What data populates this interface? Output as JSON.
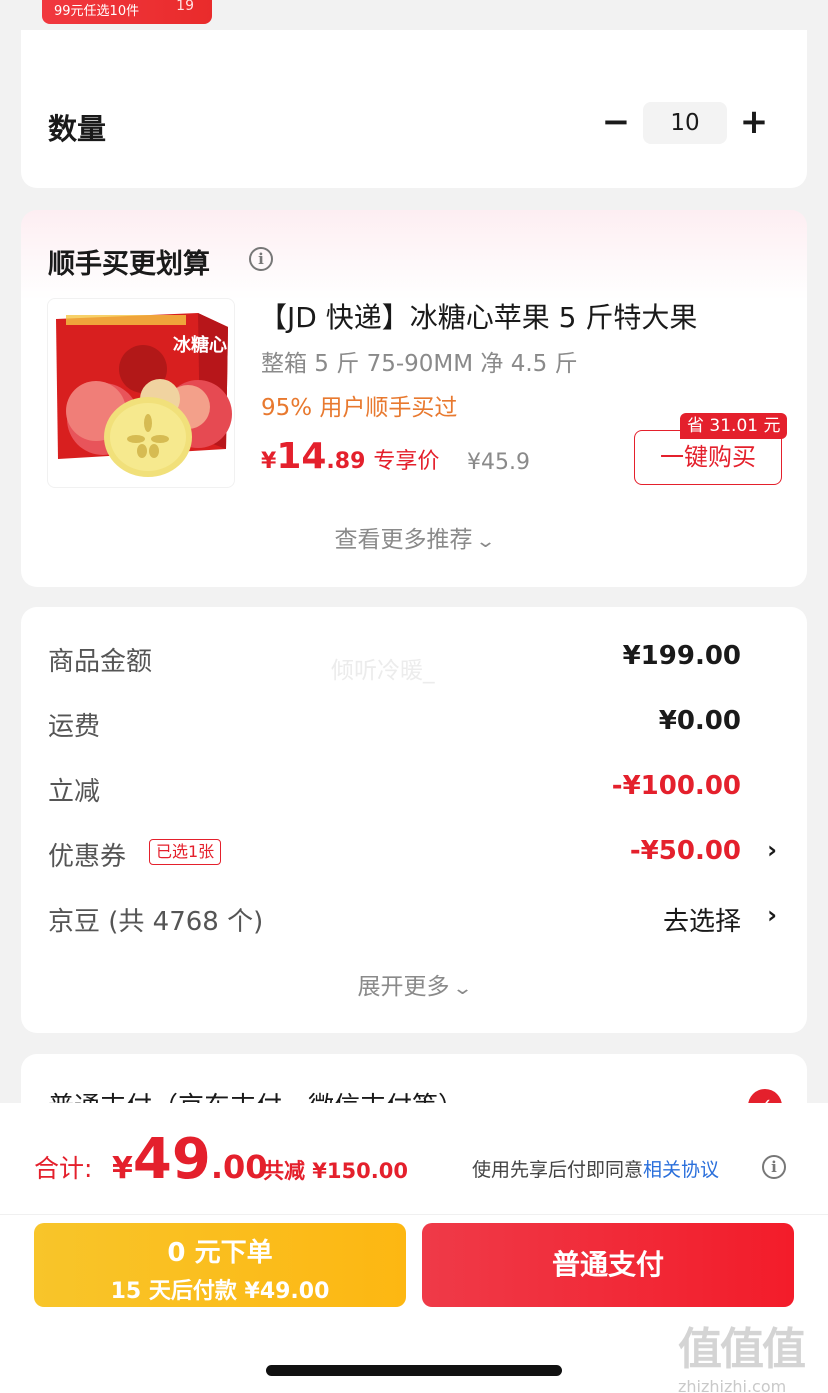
{
  "top": {
    "promo_badge": "99元任选10件",
    "promo_num": "19"
  },
  "quantity": {
    "label": "数量",
    "minus": "−",
    "value": "10",
    "plus": "+"
  },
  "recommend": {
    "title": "顺手买更划算",
    "info_icon": "i",
    "product": {
      "name": "【JD 快递】冰糖心苹果 5 斤特大果",
      "spec": "整箱 5 斤 75-90MM 净 4.5 斤",
      "users": "95% 用户顺手买过",
      "price_currency": "¥",
      "price_int": "14",
      "price_dec": ".89",
      "price_tag": "专享价",
      "old_price": "¥45.9",
      "box_text": "冰糖心",
      "save_tag": "省 31.01 元",
      "buy_button": "一键购买"
    },
    "more": "查看更多推荐"
  },
  "summary": {
    "watermark_user": "倾听冷暖_",
    "rows": [
      {
        "label": "商品金额",
        "value": "¥199.00"
      },
      {
        "label": "运费",
        "value": "¥0.00"
      },
      {
        "label": "立减",
        "value": "-¥100.00"
      },
      {
        "label": "优惠券",
        "value": "-¥50.00",
        "tag": "已选1张",
        "arrow": "›"
      },
      {
        "label": "京豆 (共 4768 个)",
        "value": "去选择",
        "arrow": "›"
      }
    ],
    "expand": "展开更多"
  },
  "payment": {
    "label": "普通支付（京东支付、微信支付等）",
    "radio_icon": "✓"
  },
  "bottom": {
    "total_label": "合计:",
    "total_currency": "¥",
    "total_int": "49",
    "total_dec": ".00",
    "total_saved": "共减 ¥150.00",
    "agree_text": "使用先享后付即同意",
    "agree_link": "相关协议",
    "later_line1": "0 元下单",
    "later_line2": "15 天后付款 ¥49.00",
    "pay_button": "普通支付"
  },
  "site_watermark": {
    "big": "值值值",
    "small": "zhizhizhi.com"
  },
  "colors": {
    "accent_red": "#e4202c",
    "orange": "#e8792f",
    "yellow_button": "#fdb712",
    "link_blue": "#2a6fdb"
  }
}
